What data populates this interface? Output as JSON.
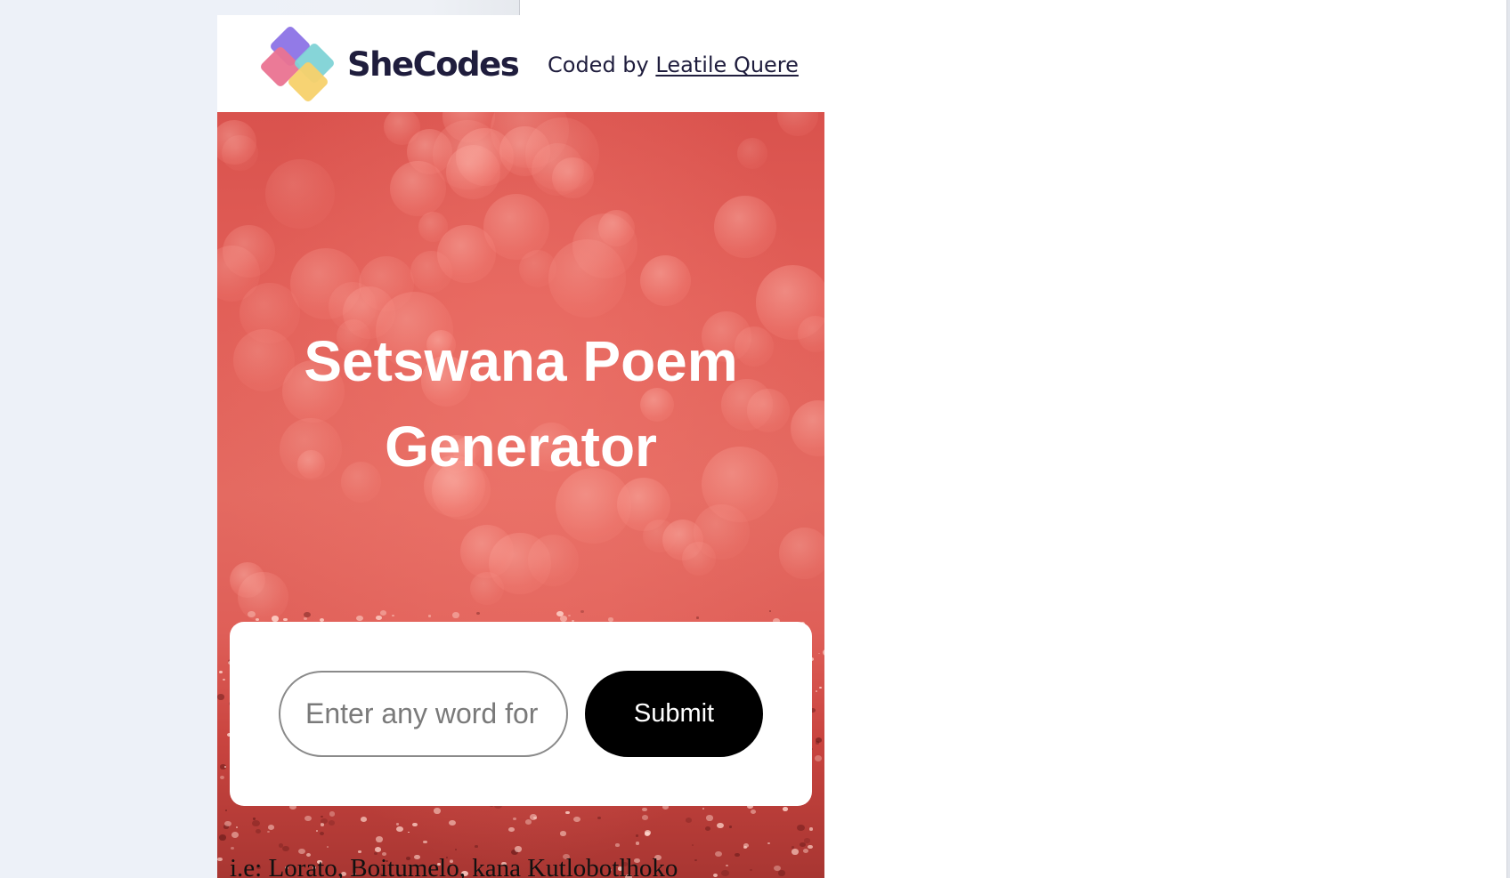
{
  "header": {
    "logo_text": "SheCodes",
    "credit_prefix": "Coded by ",
    "credit_author": "Leatile Quere"
  },
  "hero": {
    "title_line1": "Setswana Poem",
    "title_line2": "Generator"
  },
  "form": {
    "input_placeholder": "Enter any word for",
    "submit_label": "Submit"
  },
  "hint": {
    "text": "i.e: Lorato, Boitumelo, kana Kutlobotlhoko"
  },
  "colors": {
    "brand_dark": "#1f1d3d",
    "glitter_red": "#e25f58",
    "button_bg": "#000000",
    "page_side": "#edf1f8"
  }
}
